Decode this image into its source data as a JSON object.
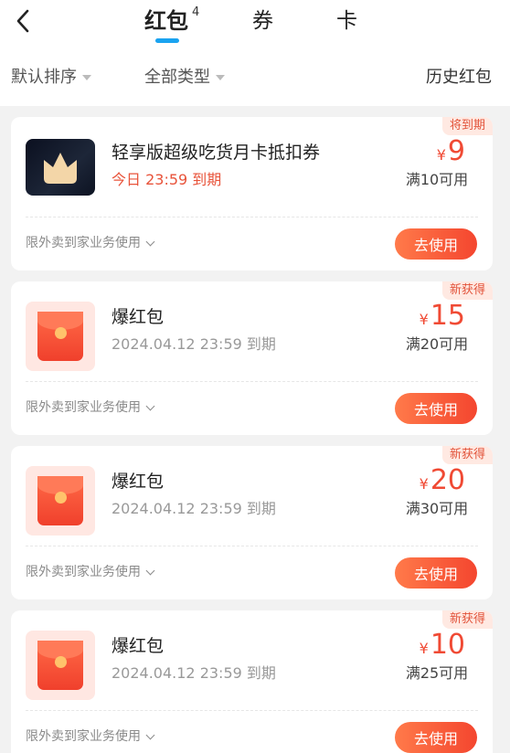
{
  "header": {
    "tabs": [
      {
        "label": "红包",
        "badge": "4"
      },
      {
        "label": "券"
      },
      {
        "label": "卡"
      }
    ],
    "filters": {
      "sort": "默认排序",
      "type": "全部类型",
      "history": "历史红包"
    }
  },
  "colors": {
    "accent": "#f04a34",
    "tab_indicator": "#1aa3f0",
    "button": "#f4462f"
  },
  "cards": [
    {
      "tag": "将到期",
      "title": "轻享版超级吃货月卡抵扣券",
      "expire": "今日 23:59 到期",
      "amount": "9",
      "currency": "¥",
      "condition": "满10可用",
      "scope": "限外卖到家业务使用",
      "button": "去使用",
      "icon": "crown-icon"
    },
    {
      "tag": "新获得",
      "title": "爆红包",
      "expire": "2024.04.12 23:59 到期",
      "amount": "15",
      "currency": "¥",
      "condition": "满20可用",
      "scope": "限外卖到家业务使用",
      "button": "去使用",
      "icon": "red-packet-icon"
    },
    {
      "tag": "新获得",
      "title": "爆红包",
      "expire": "2024.04.12 23:59 到期",
      "amount": "20",
      "currency": "¥",
      "condition": "满30可用",
      "scope": "限外卖到家业务使用",
      "button": "去使用",
      "icon": "red-packet-icon"
    },
    {
      "tag": "新获得",
      "title": "爆红包",
      "expire": "2024.04.12 23:59 到期",
      "amount": "10",
      "currency": "¥",
      "condition": "满25可用",
      "scope": "限外卖到家业务使用",
      "button": "去使用",
      "icon": "red-packet-icon"
    }
  ]
}
